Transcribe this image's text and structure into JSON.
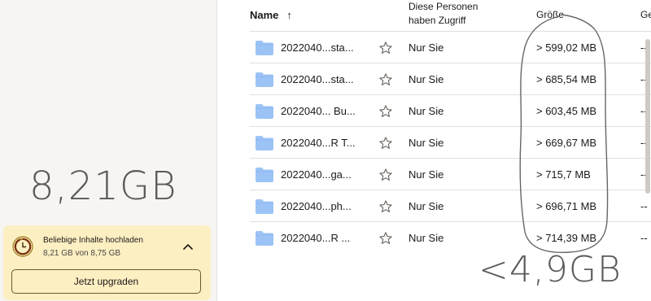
{
  "sidebar": {
    "storage": {
      "title": "Beliebige Inhalte hochladen",
      "usage": "8,21 GB von 8,75 GB",
      "upgrade_label": "Jetzt upgraden",
      "used_fraction": 0.938
    }
  },
  "table": {
    "columns": {
      "name": "Name",
      "sort_arrow": "↑",
      "access": "Diese Personen haben Zugriff",
      "access_line1": "Diese Personen",
      "access_line2": "haben Zugriff",
      "size": "Größe",
      "extra": "Ge"
    },
    "rows": [
      {
        "name": "2022040...sta...",
        "access": "Nur Sie",
        "size": "> 599,02 MB",
        "extra": "--"
      },
      {
        "name": "2022040...sta...",
        "access": "Nur Sie",
        "size": "> 685,54 MB",
        "extra": "--"
      },
      {
        "name": "2022040... Bu...",
        "access": "Nur Sie",
        "size": "> 603,45 MB",
        "extra": "--"
      },
      {
        "name": "2022040...R T...",
        "access": "Nur Sie",
        "size": "> 669,67 MB",
        "extra": "--"
      },
      {
        "name": "2022040...ga...",
        "access": "Nur Sie",
        "size": "> 715,7 MB",
        "extra": "--"
      },
      {
        "name": "2022040...ph...",
        "access": "Nur Sie",
        "size": "> 696,71 MB",
        "extra": "--"
      },
      {
        "name": "2022040...R ...",
        "access": "Nur Sie",
        "size": "> 714,39 MB",
        "extra": "--"
      }
    ]
  },
  "annotations": {
    "total_label": "8,21GB",
    "sum_label": "<4,9GB"
  },
  "colors": {
    "folder": "#9cc3f5",
    "storage_card": "#fcefc2",
    "sidebar_bg": "#f7f5f2",
    "annotation": "#555555"
  },
  "icons": {
    "folder": "folder-icon",
    "star": "star-icon",
    "storage": "storage-clock-icon",
    "chevron": "chevron-up-icon"
  }
}
